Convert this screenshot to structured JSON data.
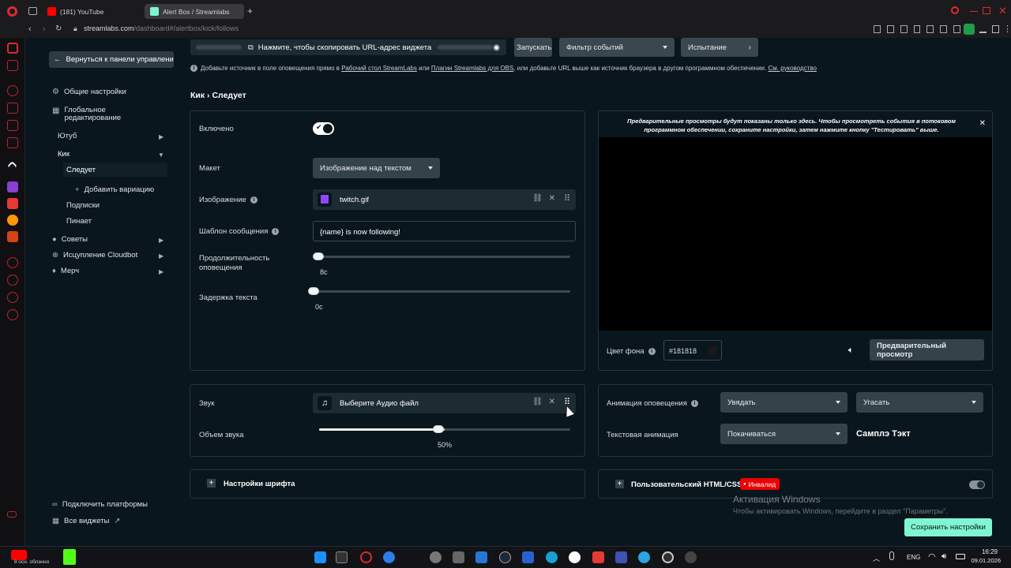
{
  "browser": {
    "tabs": [
      {
        "label": "(181) YouTube"
      },
      {
        "label": "Alert Box / Streamlabs"
      }
    ],
    "new_tab": "+",
    "url_host": "streamlabs.com",
    "url_path": "/dashboard#/alertbox/kick/follows"
  },
  "sidebar": {
    "back": "Вернуться к панели управления",
    "general": "Общие настройки",
    "global_edit": "Глобальное редактирование",
    "youtube": "Ютуб",
    "kick": "Кик",
    "follows": "Следует",
    "add_variation": "Добавить вариацию",
    "subs": "Подписки",
    "pins": "Пинает",
    "tips": "Советы",
    "cloudbot": "Исцупление Cloudbot",
    "merch": "Мерч",
    "connect": "Подключить платформы",
    "all_widgets": "Все виджеты"
  },
  "topbar": {
    "copy_url": "Нажмите, чтобы скопировать URL-адрес виджета",
    "launch": "Запускать",
    "filter": "Фильтр событий",
    "test": "Испытание",
    "hint_a": "Добавьте источник в поле оповещения прямо в",
    "hint_link1": "Рабочий стол StreamLabs",
    "hint_b": "или",
    "hint_link2": "Плагин Streamlabs для OBS",
    "hint_c": ", или добавьте URL выше как источник браузера в другом программном обеспечении.",
    "hint_link3": "См. руководство"
  },
  "breadcrumb": {
    "root": "Кик",
    "sep": "›",
    "current": "Следует"
  },
  "settings": {
    "enabled_label": "Включено",
    "layout_label": "Макет",
    "layout_value": "Изображение над текстом",
    "image_label": "Изображение",
    "image_file": "twitch.gif",
    "template_label": "Шаблон сообщения",
    "template_value": "{name} is now following!",
    "duration_label": "Продолжительность оповещения",
    "duration_value": "8с",
    "duration_level": 0.0,
    "delay_label": "Задержка текста",
    "delay_value": "0с",
    "delay_level": 0.0
  },
  "sound": {
    "label": "Звук",
    "file_placeholder": "Выберите Аудио файл",
    "volume_label": "Объем звука",
    "volume_value": "50%",
    "volume_level": 0.5
  },
  "font": {
    "label": "Настройки шрифта",
    "toggle": "+"
  },
  "preview": {
    "notice": "Предварительные просмотры будут показаны только здесь. Чтобы просмотреть события в потоковом программном обеспечении, сохраните настройки, затем нажмите кнопку \"Тестировать\" выше.",
    "bg_label": "Цвет фона",
    "bg_value": "#181818",
    "preview_btn": "Предварительный просмотр"
  },
  "animation": {
    "alert_label": "Анимация оповещения",
    "in_value": "Увядать",
    "out_value": "Угасать",
    "text_label": "Текстовая анимация",
    "text_value": "Покачиваться",
    "sample": "Самплэ Тэкт"
  },
  "custom": {
    "label": "Пользовательский HTML/CSS",
    "badge": "Инвалид",
    "toggle": "+"
  },
  "save": "Сохранить настройки",
  "watermark": {
    "title": "Активация Windows",
    "sub": "Чтобы активировать Windows, перейдите в раздел \"Параметры\"."
  },
  "taskbar": {
    "weather": "8 осн. облачно",
    "lang": "ENG",
    "time": "16:29",
    "date": "09.01.2026"
  },
  "colors": {
    "accent": "#80f5d2",
    "badge": "#eb0000",
    "panel": "#09161d"
  }
}
